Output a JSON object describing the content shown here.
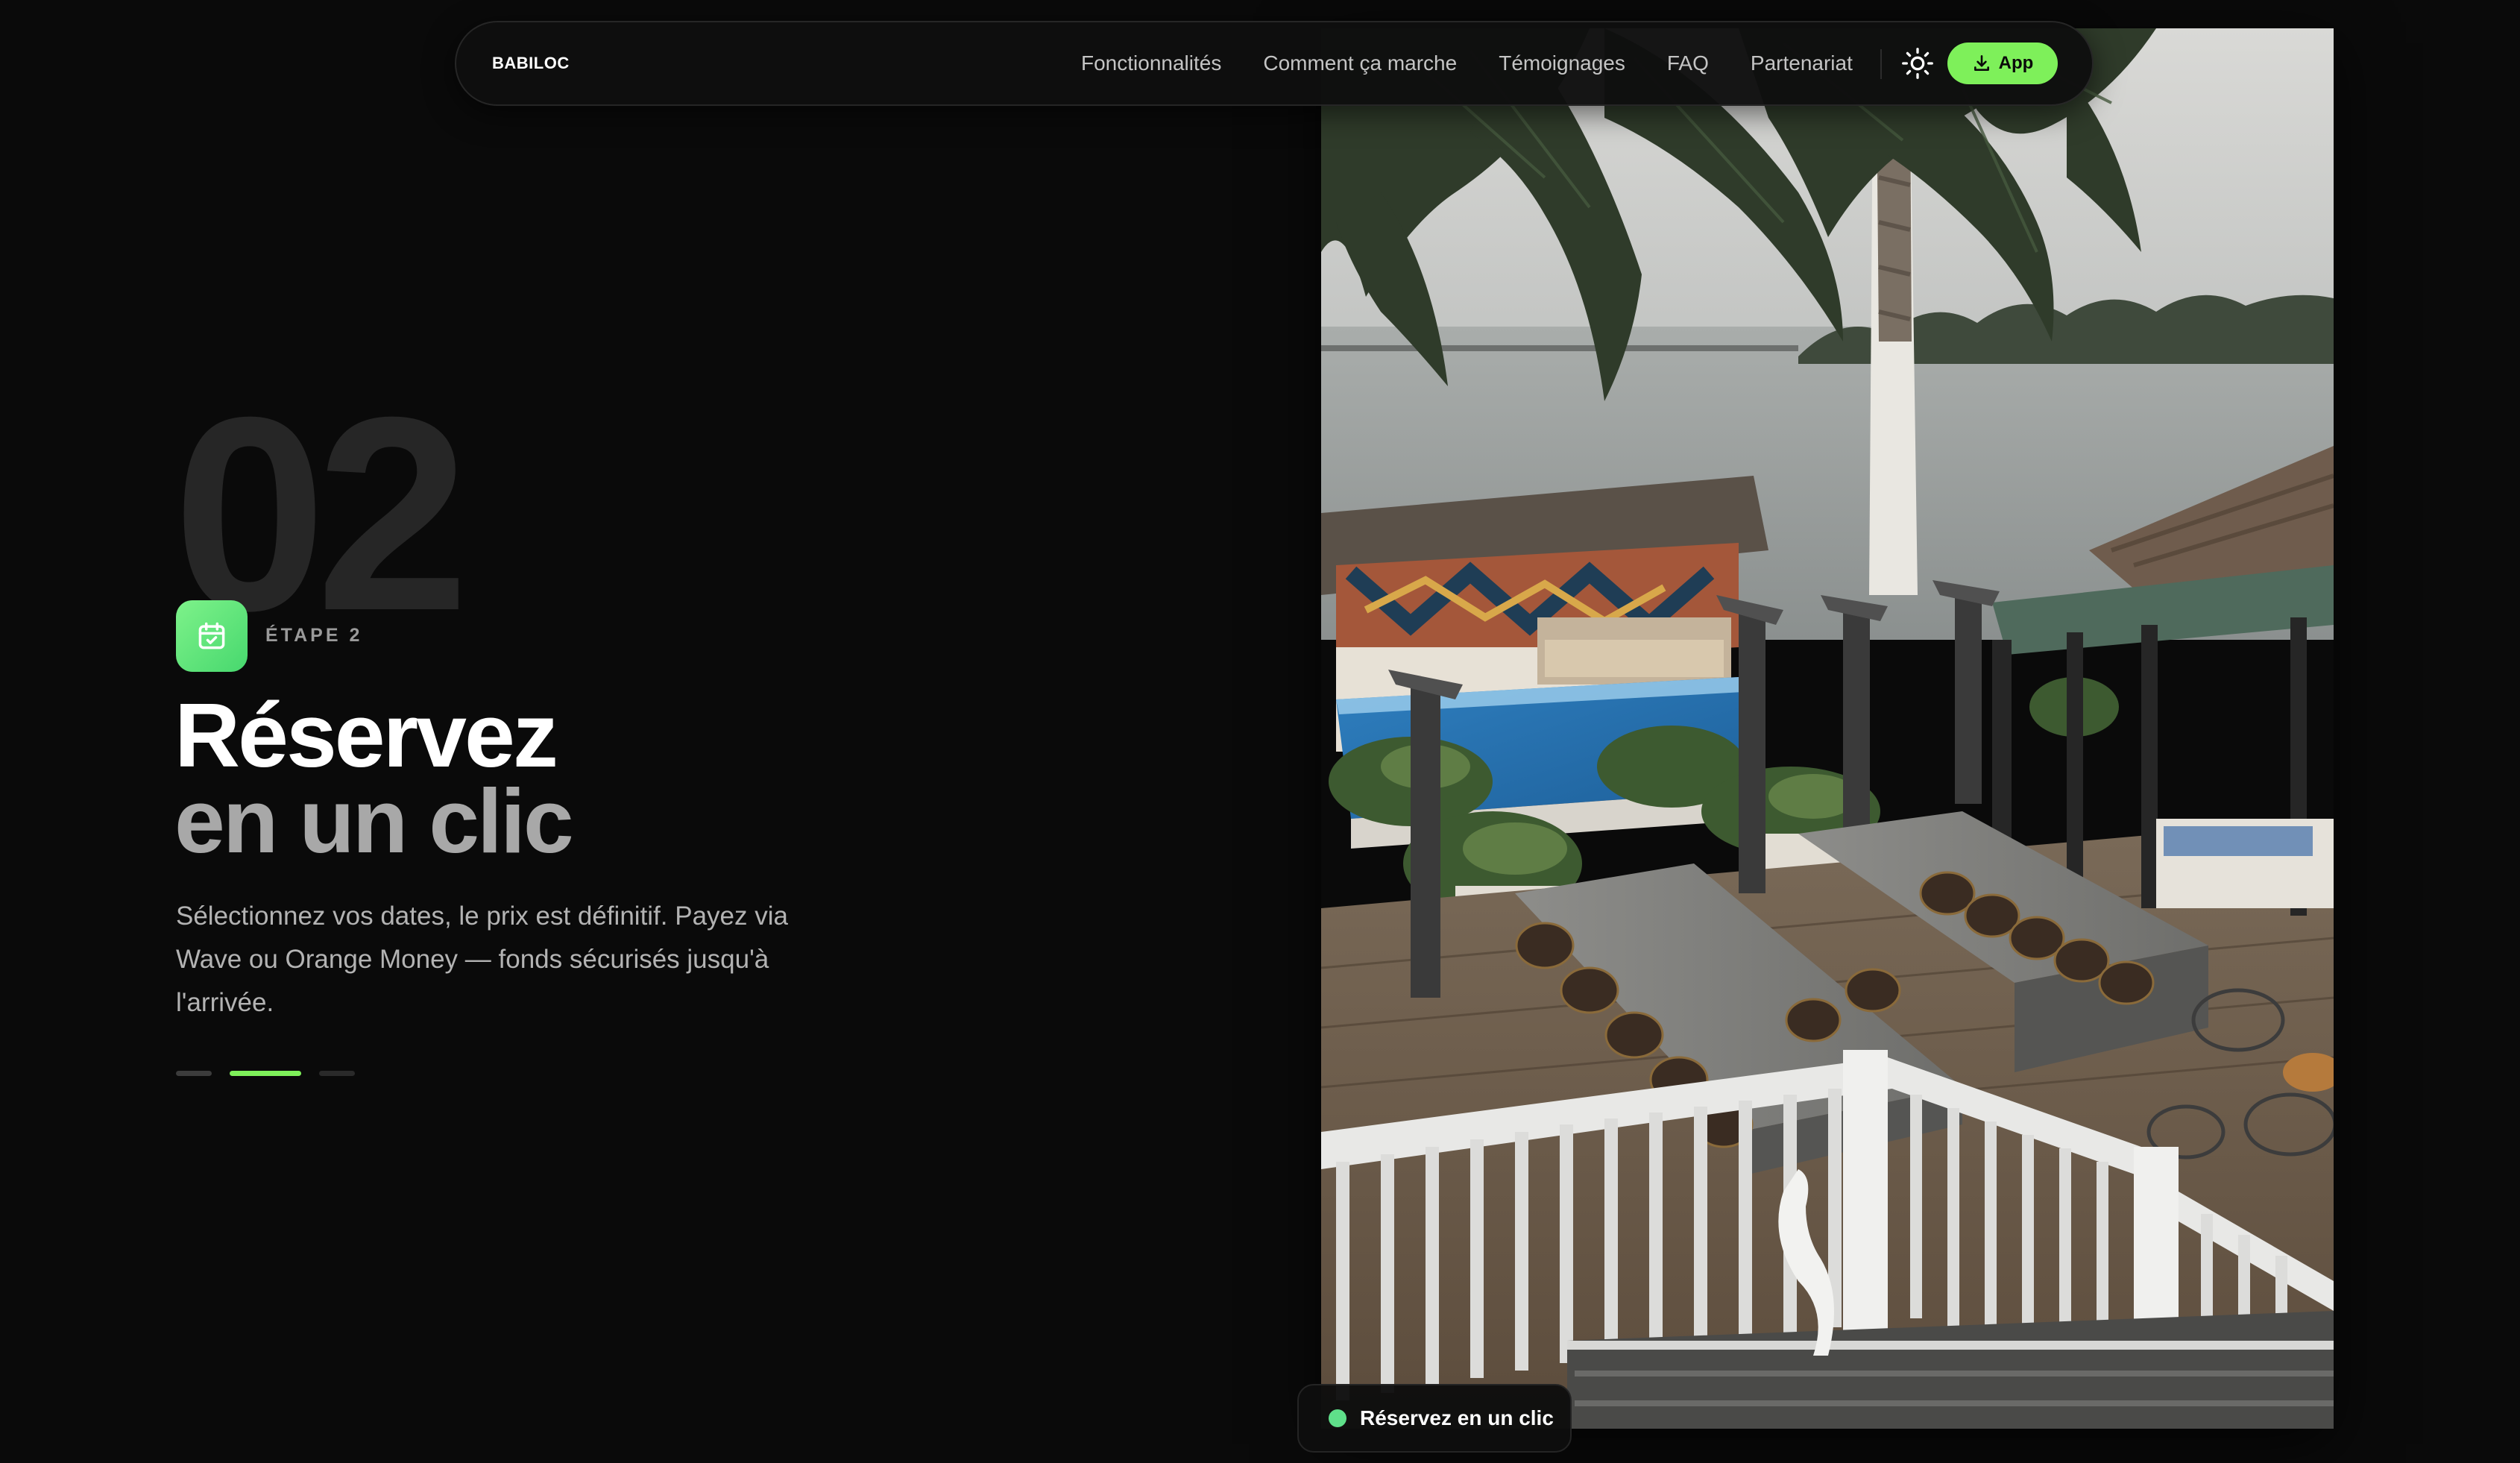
{
  "brand": {
    "logo_text": "BABILOC",
    "accent_color": "#7ef05a"
  },
  "nav": {
    "links": [
      "Fonctionnalités",
      "Comment ça marche",
      "Témoignages",
      "FAQ",
      "Partenariat"
    ],
    "theme_icon": "sun-icon",
    "app_button": {
      "label": "App",
      "icon": "download-icon"
    }
  },
  "step": {
    "number": "02",
    "icon": "calendar-check-icon",
    "label": "ÉTAPE 2",
    "title_line1": "Réservez",
    "title_line2": "en un clic",
    "description": "Sélectionnez vos dates, le prix est définitif. Payez via Wave ou Orange Money — fonds sécurisés jusqu'à l'arrivée.",
    "progress": {
      "total_steps": 3,
      "active_index": 1
    }
  },
  "media": {
    "caption": "Réservez en un clic",
    "caption_status_color": "#5fe08a"
  }
}
